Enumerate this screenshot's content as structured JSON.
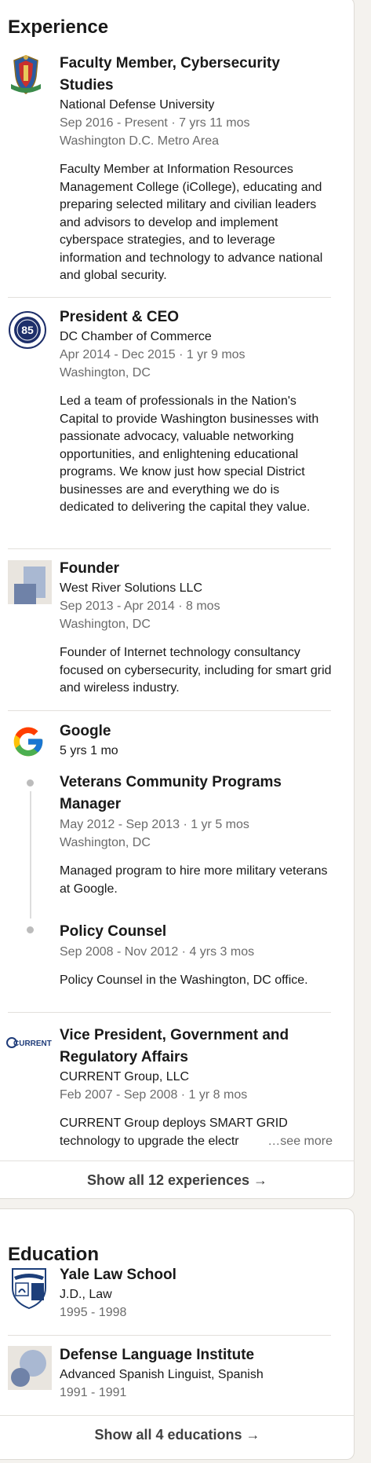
{
  "experience": {
    "section_title": "Experience",
    "entries": [
      {
        "logo_icon": "university-crest-icon",
        "title": "Faculty Member, Cybersecurity Studies",
        "company": "National Defense University",
        "dates": "Sep 2016 - Present · 7 yrs 11 mos",
        "location": "Washington D.C. Metro Area",
        "description": "Faculty Member at Information Resources Management College (iCollege), educating and preparing selected military and civilian leaders and advisors to develop and implement cyberspace strategies, and to leverage information and technology to advance national and global security."
      },
      {
        "logo_icon": "chamber-seal-icon",
        "logo_text": "85",
        "title": "President & CEO",
        "company": "DC Chamber of Commerce",
        "dates": "Apr 2014 - Dec 2015 · 1 yr 9 mos",
        "location": "Washington, DC",
        "description": "Led a team of professionals in the Nation's Capital to provide Washington businesses with passionate advocacy, valuable networking opportunities, and enlightening educational programs. We know just how special District businesses are and everything we do is dedicated to delivering the capital they value."
      },
      {
        "logo_icon": "company-placeholder-icon",
        "title": "Founder",
        "company": "West River Solutions LLC",
        "dates": "Sep 2013 - Apr 2014 · 8 mos",
        "location": "Washington, DC",
        "description": "Founder of Internet technology consultancy focused on cybersecurity, including for smart grid and wireless industry."
      },
      {
        "logo_icon": "google-g-icon",
        "company": "Google",
        "duration": "5 yrs 1 mo",
        "roles": [
          {
            "title": "Veterans Community Programs Manager",
            "dates": "May 2012 - Sep 2013 · 1 yr 5 mos",
            "location": "Washington, DC",
            "description": "Managed program to hire more military veterans at Google."
          },
          {
            "title": "Policy Counsel",
            "dates": "Sep 2008 - Nov 2012 · 4 yrs 3 mos",
            "description": "Policy Counsel in the Washington, DC office."
          }
        ]
      },
      {
        "logo_icon": "current-logo-icon",
        "logo_text": "CURRENT",
        "title": "Vice President, Government and Regulatory Affairs",
        "company": "CURRENT Group, LLC",
        "dates": "Feb 2007 - Sep 2008 · 1 yr 8 mos",
        "description_line1": "CURRENT Group deploys SMART GRID",
        "description_line2": "technology to upgrade the electr",
        "see_more": "…see more"
      }
    ],
    "show_all": "Show all 12 experiences →"
  },
  "education": {
    "section_title": "Education",
    "entries": [
      {
        "logo_icon": "yale-shield-icon",
        "school": "Yale Law School",
        "degree": "J.D., Law",
        "years": "1995 - 1998"
      },
      {
        "logo_icon": "school-placeholder-icon",
        "school": "Defense Language Institute",
        "degree": "Advanced Spanish Linguist, Spanish",
        "years": "1991 - 1991"
      }
    ],
    "show_all": "Show all 4 educations →"
  }
}
